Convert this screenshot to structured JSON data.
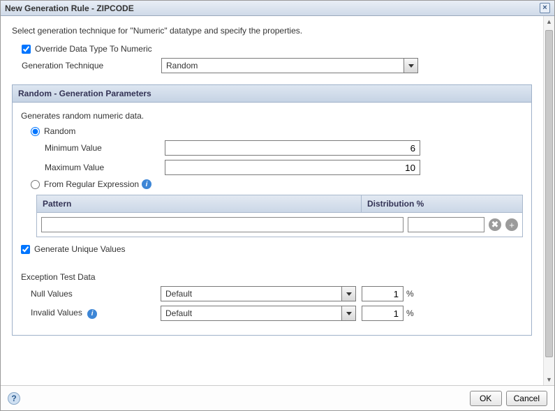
{
  "dialog": {
    "title": "New Generation Rule - ZIPCODE",
    "intro": "Select generation technique for \"Numeric\" datatype and specify the properties.",
    "override_label": "Override Data Type To Numeric",
    "override_checked": true,
    "gen_tech_label": "Generation Technique",
    "gen_tech_value": "Random"
  },
  "panel": {
    "header": "Random - Generation Parameters",
    "description": "Generates random numeric data.",
    "random_label": "Random",
    "random_selected": true,
    "min_label": "Minimum Value",
    "min_value": "6",
    "max_label": "Maximum Value",
    "max_value": "10",
    "regex_label": "From Regular Expression",
    "regex_selected": false,
    "regex_table": {
      "col_pattern": "Pattern",
      "col_distribution": "Distribution %",
      "pattern_value": "",
      "distribution_value": ""
    },
    "unique_label": "Generate Unique Values",
    "unique_checked": true
  },
  "exception": {
    "header": "Exception Test Data",
    "null_label": "Null Values",
    "null_select": "Default",
    "null_pct": "1",
    "invalid_label": "Invalid Values",
    "invalid_select": "Default",
    "invalid_pct": "1",
    "pct_symbol": "%"
  },
  "footer": {
    "ok": "OK",
    "cancel": "Cancel"
  },
  "icons": {
    "info": "i",
    "help": "?",
    "close": "×",
    "delete": "✖",
    "add": "+"
  }
}
